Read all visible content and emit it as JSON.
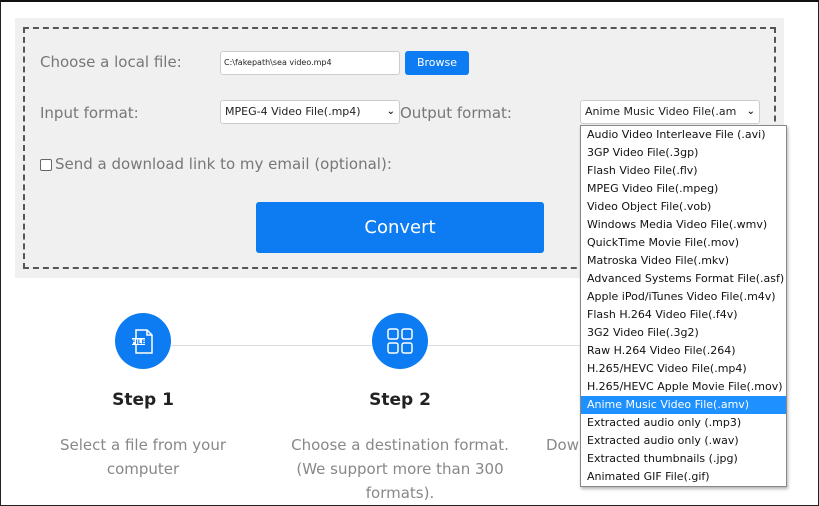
{
  "form": {
    "file_label": "Choose a local file:",
    "file_value": "C:\\fakepath\\sea video.mp4",
    "browse_label": "Browse",
    "input_format_label": "Input format:",
    "input_format_value": "MPEG-4 Video File(.mp4)",
    "output_format_label": "Output format:",
    "output_format_value": "Anime Music Video File(.am",
    "email_label": "Send a download link to my email (optional):",
    "email_checked": false,
    "convert_label": "Convert"
  },
  "steps": [
    {
      "title": "Step 1",
      "desc_lines": [
        "Select a file from your",
        "computer"
      ],
      "icon": "file-icon"
    },
    {
      "title": "Step 2",
      "desc_lines": [
        "Choose a destination format.",
        "(We support more than 300",
        "formats)."
      ],
      "icon": "grid-icon"
    },
    {
      "desc_partial": "Dow"
    }
  ],
  "dropdown": {
    "options": [
      "Audio Video Interleave File (.avi)",
      "3GP Video File(.3gp)",
      "Flash Video File(.flv)",
      "MPEG Video File(.mpeg)",
      "Video Object File(.vob)",
      "Windows Media Video File(.wmv)",
      "QuickTime Movie File(.mov)",
      "Matroska Video File(.mkv)",
      "Advanced Systems Format File(.asf)",
      "Apple iPod/iTunes Video File(.m4v)",
      "Flash H.264 Video File(.f4v)",
      "3G2 Video File(.3g2)",
      "Raw H.264 Video File(.264)",
      "H.265/HEVC Video File(.mp4)",
      "H.265/HEVC Apple Movie File(.mov)",
      "Anime Music Video File(.amv)",
      "Extracted audio only (.mp3)",
      "Extracted audio only (.wav)",
      "Extracted thumbnails (.jpg)",
      "Animated GIF File(.gif)"
    ],
    "selected_index": 15
  },
  "colors": {
    "accent": "#0d7cf2",
    "selected": "#1e90ff"
  }
}
